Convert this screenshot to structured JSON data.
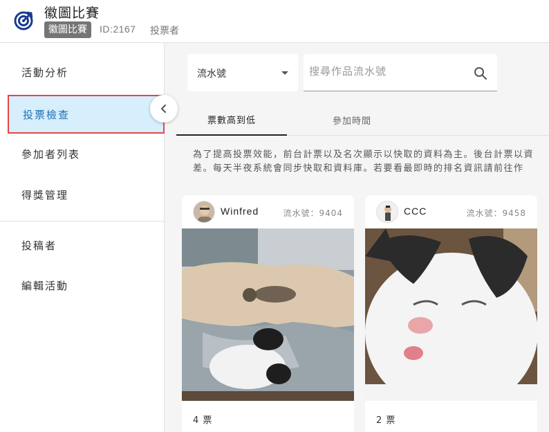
{
  "header": {
    "title": "徽圖比賽",
    "tag": "徽圖比賽",
    "id_text": "ID:2167",
    "role": "投票者"
  },
  "sidebar": {
    "items": [
      {
        "label": "活動分析"
      },
      {
        "label": "投票檢查"
      },
      {
        "label": "參加者列表"
      },
      {
        "label": "得獎管理"
      },
      {
        "label": "投稿者"
      },
      {
        "label": "編輯活動"
      }
    ],
    "active_index": 1
  },
  "filter": {
    "sort_label": "流水號",
    "search_placeholder": "搜尋作品流水號"
  },
  "tabs": [
    {
      "label": "票數高到低"
    },
    {
      "label": "參加時間"
    }
  ],
  "notice": {
    "line1": "為了提高投票效能，前台計票以及名次顯示以快取的資料為主。後台計票以資",
    "line2": "差。每天半夜系統會同步快取和資料庫。若要看最即時的排名資訊請前往作"
  },
  "cards": [
    {
      "author": "Winfred",
      "serial": "流水號：9404",
      "votes": "4 票"
    },
    {
      "author": "CCC",
      "serial": "流水號：9458",
      "votes": "2 票"
    }
  ],
  "colors": {
    "accent": "#1a6fb5",
    "active_bg": "#d7eefc",
    "highlight_border": "#e04848"
  }
}
